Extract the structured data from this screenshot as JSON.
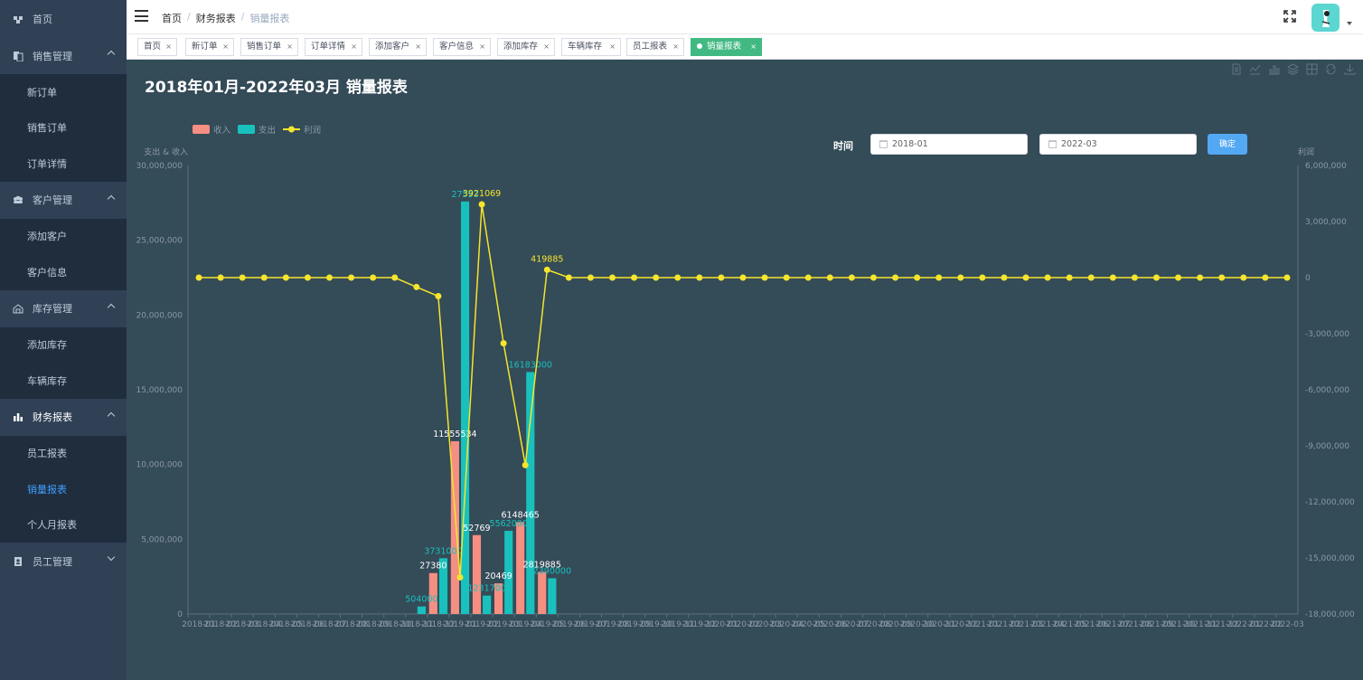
{
  "sidebar": {
    "home": "首页",
    "sales": {
      "label": "销售管理",
      "items": [
        "新订单",
        "销售订单",
        "订单详情"
      ]
    },
    "customer": {
      "label": "客户管理",
      "items": [
        "添加客户",
        "客户信息"
      ]
    },
    "inventory": {
      "label": "库存管理",
      "items": [
        "添加库存",
        "车辆库存"
      ]
    },
    "finance": {
      "label": "财务报表",
      "items": [
        "员工报表",
        "销量报表",
        "个人月报表"
      ]
    },
    "staff": {
      "label": "员工管理"
    }
  },
  "header": {
    "breadcrumb": [
      "首页",
      "财务报表",
      "销量报表"
    ]
  },
  "tags": [
    "首页",
    "新订单",
    "销售订单",
    "订单详情",
    "添加客户",
    "客户信息",
    "添加库存",
    "车辆库存",
    "员工报表",
    "销量报表"
  ],
  "page": {
    "title": "2018年01月-2022年03月 销量报表",
    "date_label": "时间",
    "start_date": "2018-01",
    "end_date": "2022-03",
    "confirm": "确定"
  },
  "colors": {
    "income": "#f48f82",
    "expense": "#19c1bd",
    "profit": "#f5e52d",
    "active_tag": "#42b983"
  },
  "chart_data": {
    "type": "bar",
    "legend": [
      "收入",
      "支出",
      "利润"
    ],
    "left_axis_label": "支出 & 收入",
    "right_axis_label": "利润",
    "left_ticks": [
      "30,000,000",
      "25,000,000",
      "20,000,000",
      "15,000,000",
      "10,000,000",
      "5,000,000",
      "0"
    ],
    "right_ticks": [
      "6,000,000",
      "3,000,000",
      "0",
      "-3,000,000",
      "-6,000,000",
      "-9,000,000",
      "-12,000,000",
      "-15,000,000",
      "-18,000,000"
    ],
    "ylim_left": [
      0,
      30000000
    ],
    "ylim_right": [
      -18000000,
      6000000
    ],
    "x": [
      "2018-01",
      "2018-02",
      "2018-03",
      "2018-04",
      "2018-05",
      "2018-06",
      "2018-07",
      "2018-08",
      "2018-09",
      "2018-10",
      "2018-11",
      "2018-12",
      "2019-01",
      "2019-02",
      "2019-03",
      "2019-04",
      "2019-05",
      "2019-06",
      "2019-07",
      "2019-08",
      "2019-09",
      "2019-10",
      "2019-11",
      "2019-12",
      "2020-01",
      "2020-02",
      "2020-03",
      "2020-04",
      "2020-05",
      "2020-06",
      "2020-07",
      "2020-08",
      "2020-09",
      "2020-10",
      "2020-11",
      "2020-12",
      "2021-01",
      "2021-02",
      "2021-03",
      "2021-04",
      "2021-05",
      "2021-06",
      "2021-07",
      "2021-08",
      "2021-09",
      "2021-10",
      "2021-11",
      "2021-12",
      "2022-01",
      "2022-02",
      "2022-03"
    ],
    "series": [
      {
        "name": "收入",
        "values": [
          0,
          0,
          0,
          0,
          0,
          0,
          0,
          0,
          0,
          0,
          0,
          2738000,
          11555534,
          5276900,
          2046900,
          6148465,
          2819885,
          0,
          0,
          0,
          0,
          0,
          0,
          0,
          0,
          0,
          0,
          0,
          0,
          0,
          0,
          0,
          0,
          0,
          0,
          0,
          0,
          0,
          0,
          0,
          0,
          0,
          0,
          0,
          0,
          0,
          0,
          0,
          0,
          0,
          0
        ],
        "labels": [
          "",
          "",
          "",
          "",
          "",
          "",
          "",
          "",
          "",
          "",
          "",
          "27380",
          "11555534",
          "52769",
          "20469",
          "6148465",
          "2819885",
          "",
          "",
          "",
          "",
          "",
          "",
          "",
          "",
          "",
          "",
          "",
          "",
          "",
          "",
          "",
          "",
          "",
          "",
          "",
          "",
          "",
          "",
          "",
          "",
          "",
          "",
          "",
          "",
          "",
          "",
          "",
          "",
          "",
          ""
        ]
      },
      {
        "name": "支出",
        "values": [
          0,
          0,
          0,
          0,
          0,
          0,
          0,
          0,
          0,
          0,
          504000,
          3731000,
          27593000,
          1231700,
          5562000,
          16183000,
          2390000,
          0,
          0,
          0,
          0,
          0,
          0,
          0,
          0,
          0,
          0,
          0,
          0,
          0,
          0,
          0,
          0,
          0,
          0,
          0,
          0,
          0,
          0,
          0,
          0,
          0,
          0,
          0,
          0,
          0,
          0,
          0,
          0,
          0,
          0
        ],
        "labels": [
          "",
          "",
          "",
          "",
          "",
          "",
          "",
          "",
          "",
          "",
          "504000",
          "3731000",
          "27593",
          "1231700",
          "5562000",
          "16183000",
          "2390000",
          "",
          "",
          "",
          "",
          "",
          "",
          "",
          "",
          "",
          "",
          "",
          "",
          "",
          "",
          "",
          "",
          "",
          "",
          "",
          "",
          "",
          "",
          "",
          "",
          "",
          "",
          "",
          "",
          "",
          "",
          "",
          "",
          "",
          ""
        ]
      },
      {
        "name": "利润",
        "values": [
          0,
          0,
          0,
          0,
          0,
          0,
          0,
          0,
          0,
          0,
          -504000,
          -993000,
          -16037466,
          3921069,
          -3515100,
          -10034535,
          419885,
          0,
          0,
          0,
          0,
          0,
          0,
          0,
          0,
          0,
          0,
          0,
          0,
          0,
          0,
          0,
          0,
          0,
          0,
          0,
          0,
          0,
          0,
          0,
          0,
          0,
          0,
          0,
          0,
          0,
          0,
          0,
          0,
          0,
          0
        ],
        "labels": [
          "",
          "",
          "",
          "",
          "",
          "",
          "",
          "",
          "",
          "",
          "",
          "",
          "",
          "3921069",
          "",
          "",
          "419885",
          "",
          "",
          "",
          "",
          "",
          "",
          "",
          "",
          "",
          "",
          "",
          "",
          "",
          "",
          "",
          "",
          "",
          "",
          "",
          "",
          "",
          "",
          "",
          "",
          "",
          "",
          "",
          "",
          "",
          "",
          "",
          "",
          "",
          ""
        ]
      }
    ]
  }
}
